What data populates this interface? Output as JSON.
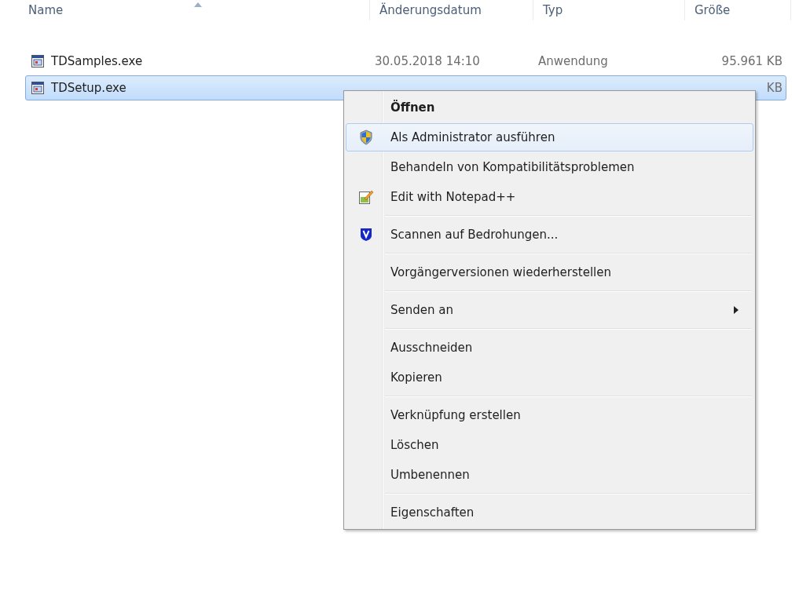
{
  "columns": [
    {
      "label": "Name",
      "sorted": true
    },
    {
      "label": "Änderungsdatum",
      "sorted": false
    },
    {
      "label": "Typ",
      "sorted": false
    },
    {
      "label": "Größe",
      "sorted": false
    }
  ],
  "files": [
    {
      "name": "TDSamples.exe",
      "date": "30.05.2018 14:10",
      "type": "Anwendung",
      "size": "95.961 KB",
      "selected": false
    },
    {
      "name": "TDSetup.exe",
      "size": "KB",
      "selected": true
    }
  ],
  "context_menu": [
    {
      "kind": "default",
      "label": "Öffnen",
      "selected": false
    },
    {
      "kind": "uac",
      "label": "Als Administrator ausführen",
      "selected": true
    },
    {
      "kind": "plain",
      "label": "Behandeln von Kompatibilitätsproblemen",
      "selected": false
    },
    {
      "kind": "notepad",
      "label": "Edit with Notepad++",
      "selected": false
    },
    {
      "kind": "separator"
    },
    {
      "kind": "scan",
      "label": "Scannen auf Bedrohungen...",
      "selected": false
    },
    {
      "kind": "separator"
    },
    {
      "kind": "plain",
      "label": "Vorgängerversionen wiederherstellen",
      "selected": false
    },
    {
      "kind": "separator"
    },
    {
      "kind": "submenu",
      "label": "Senden an",
      "selected": false
    },
    {
      "kind": "separator"
    },
    {
      "kind": "plain",
      "label": "Ausschneiden",
      "selected": false
    },
    {
      "kind": "plain",
      "label": "Kopieren",
      "selected": false
    },
    {
      "kind": "separator"
    },
    {
      "kind": "plain",
      "label": "Verknüpfung erstellen",
      "selected": false
    },
    {
      "kind": "plain",
      "label": "Löschen",
      "selected": false
    },
    {
      "kind": "plain",
      "label": "Umbenennen",
      "selected": false
    },
    {
      "kind": "separator"
    },
    {
      "kind": "plain",
      "label": "Eigenschaften",
      "selected": false
    }
  ]
}
